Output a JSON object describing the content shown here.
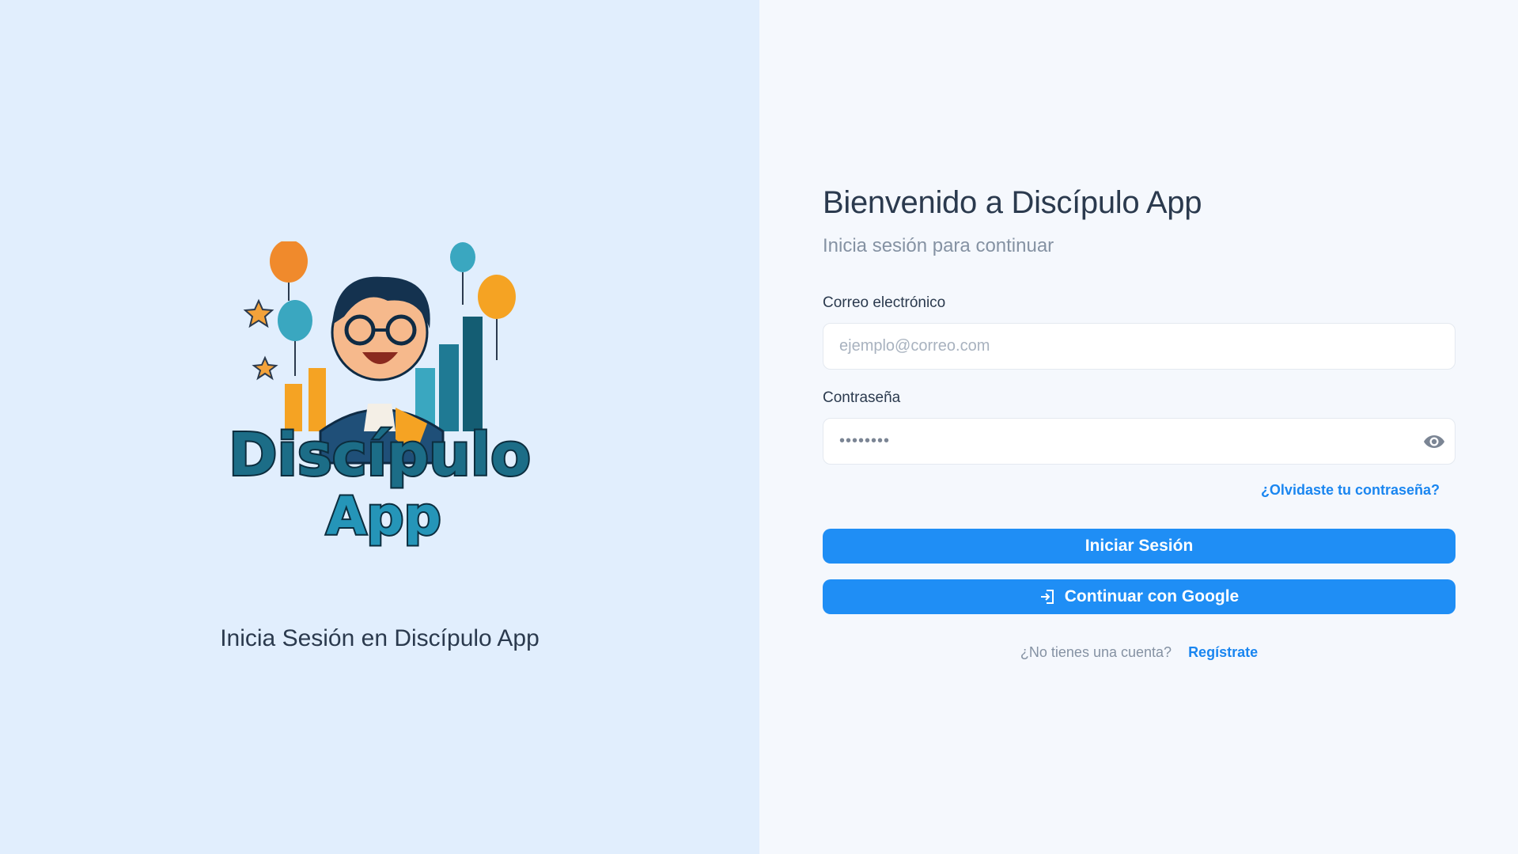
{
  "left": {
    "logo": {
      "name": "Discípulo App logo",
      "line1": "Discípulo",
      "line2": "App"
    },
    "caption": "Inicia Sesión en Discípulo App"
  },
  "form": {
    "title": "Bienvenido a Discípulo App",
    "subtitle": "Inicia sesión para continuar",
    "email": {
      "label": "Correo electrónico",
      "placeholder": "ejemplo@correo.com",
      "value": ""
    },
    "password": {
      "label": "Contraseña",
      "value": "password",
      "toggle_icon": "eye-icon"
    },
    "forgot_label": "¿Olvidaste tu contraseña?",
    "login_button": "Iniciar Sesión",
    "google_button": "Continuar con Google",
    "google_button_icon": "login-icon",
    "signup_prompt": "¿No tienes una cuenta?",
    "signup_link": "Regístrate"
  },
  "colors": {
    "left_background": "#e1eefd",
    "right_background": "#f5f8fd",
    "primary": "#1f8ef5",
    "link": "#1a86f0",
    "heading_text": "#2b3a4e",
    "muted_text": "#8592a3"
  }
}
